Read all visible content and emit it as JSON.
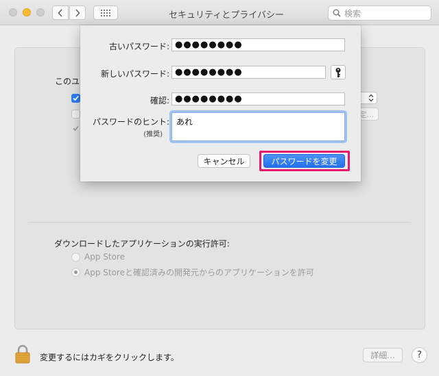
{
  "window": {
    "title": "セキュリティとプライバシー",
    "search_placeholder": "検索"
  },
  "background": {
    "user_section_label": "このユー",
    "settings_button_label": "定...",
    "download_section_title": "ダウンロードしたアプリケーションの実行許可:",
    "radio_options": [
      {
        "label": "App Store",
        "selected": false
      },
      {
        "label": "App Storeと確認済みの開発元からのアプリケーションを許可",
        "selected": true
      }
    ]
  },
  "footer": {
    "lock_text": "変更するにはカギをクリックします。",
    "details_label": "詳細...",
    "help_label": "?"
  },
  "sheet": {
    "old_password_label": "古いパスワード:",
    "old_password_value": "●●●●●●●●",
    "new_password_label": "新しいパスワード:",
    "new_password_value": "●●●●●●●●",
    "confirm_label": "確認:",
    "confirm_value": "●●●●●●●●",
    "hint_label": "パスワードのヒント:",
    "hint_sublabel": "(推奨)",
    "hint_value": "あれ",
    "cancel_label": "キャンセル",
    "change_label": "パスワードを変更"
  },
  "colors": {
    "accent": "#2f7ef6",
    "highlight": "#e6196a",
    "lock": "#e5a73a"
  }
}
